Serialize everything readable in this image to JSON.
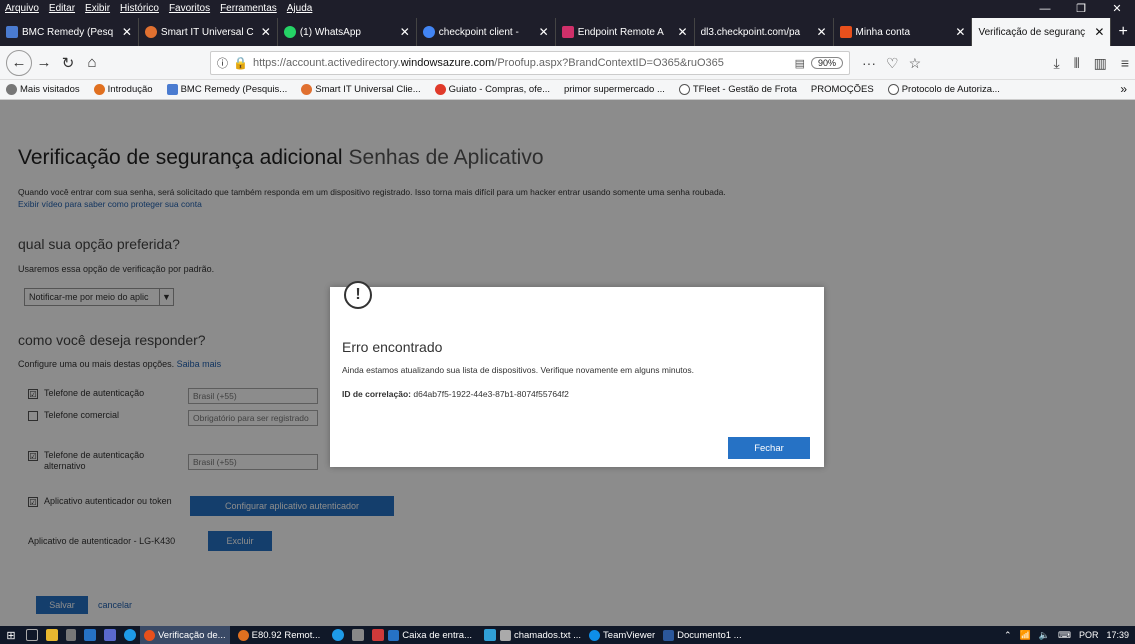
{
  "menu": [
    "Arquivo",
    "Editar",
    "Exibir",
    "Histórico",
    "Favoritos",
    "Ferramentas",
    "Ajuda"
  ],
  "window_controls": {
    "minimize": "—",
    "restore": "❐",
    "close": "✕"
  },
  "tabs": [
    {
      "label": "BMC Remedy (Pesq",
      "color": "#4a7bd0"
    },
    {
      "label": "Smart IT Universal C",
      "color": "#e07030"
    },
    {
      "label": "(1) WhatsApp",
      "color": "#25d366"
    },
    {
      "label": "checkpoint client -",
      "color": "#4285f4"
    },
    {
      "label": "Endpoint Remote A",
      "color": "#d0306a"
    },
    {
      "label": "dl3.checkpoint.com/pa",
      "color": "#888888"
    },
    {
      "label": "Minha conta",
      "color": "#e8501c"
    },
    {
      "label": "Verificação de seguranç",
      "color": "#f5f6f7"
    }
  ],
  "new_tab": "+",
  "nav": {
    "back": "←",
    "forward": "→",
    "reload": "↻",
    "home": "⌂",
    "info": "ⓘ",
    "url_prefix": "https://account.activedirectory.",
    "url_domain": "windowsazure.com",
    "url_suffix": "/Proofup.aspx?BrandContextID=O365&ruO365",
    "zoom": "90%",
    "more": "···",
    "pocket": "♡",
    "star": "☆",
    "download": "⤓",
    "library": "⫴",
    "sidebar": "▥",
    "hamburger": "≡"
  },
  "bookmarks": [
    {
      "label": "Mais visitados",
      "color": "#777777"
    },
    {
      "label": "Introdução",
      "color": "#e07020"
    },
    {
      "label": "BMC Remedy (Pesquis...",
      "color": "#4a7bd0"
    },
    {
      "label": "Smart IT Universal Clie...",
      "color": "#e07030"
    },
    {
      "label": "Guiato - Compras, ofe...",
      "color": "#e03a2a"
    },
    {
      "label": "primor supermercado ...",
      "color": "#ffffff"
    },
    {
      "label": "TFleet - Gestão de Frota",
      "color": "#555555"
    },
    {
      "label": "PROMOÇÕES",
      "color": "#ffffff"
    },
    {
      "label": "Protocolo de Autoriza...",
      "color": "#555555"
    }
  ],
  "bookmark_overflow": "»",
  "page": {
    "title": "Verificação de segurança adicional",
    "subtitle": "Senhas de Aplicativo",
    "intro": "Quando você entrar com sua senha, será solicitado que também responda em um dispositivo registrado. Isso torna mais difícil para um hacker entrar usando somente uma senha roubada.",
    "intro_link": "Exibir vídeo para saber como proteger sua conta",
    "preferred_heading": "qual sua opção preferida?",
    "preferred_note": "Usaremos essa opção de verificação por padrão.",
    "preferred_select": "Notificar-me por meio do aplic",
    "respond_heading": "como você deseja responder?",
    "respond_note": "Configure uma ou mais destas opções.",
    "respond_link": "Saiba mais",
    "options": [
      {
        "label": "Telefone de autenticação",
        "checked": "☑",
        "input": "Brasil (+55)"
      },
      {
        "label": "Telefone comercial",
        "checked": "",
        "input": "Obrigatório para ser registrado"
      },
      {
        "label": "Telefone de autenticação alternativo",
        "checked": "☑",
        "input": "Brasil (+55)"
      },
      {
        "label": "Aplicativo autenticador ou token",
        "checked": "☑",
        "input": ""
      }
    ],
    "config_app_button": "Configurar aplicativo autenticador",
    "authenticator_label": "Aplicativo de autenticador - LG-K430",
    "delete_button": "Excluir",
    "save_button": "Salvar",
    "cancel_link": "cancelar"
  },
  "dialog": {
    "icon": "!",
    "title": "Erro encontrado",
    "message": "Ainda estamos atualizando sua lista de dispositivos. Verifique novamente em alguns minutos.",
    "correlation_label": "ID de correlação:",
    "correlation_id": "d64ab7f5-1922-44e3-87b1-8074f55764f2",
    "close_button": "Fechar"
  },
  "taskbar": {
    "items": [
      {
        "label": "Verificação de...",
        "color": "#e8501c"
      },
      {
        "label": "E80.92 Remot...",
        "color": "#e07020"
      },
      {
        "label": "Caixa de entra...",
        "color": "#2672c5"
      },
      {
        "label": "chamados.txt ...",
        "color": "#aaaaaa"
      },
      {
        "label": "TeamViewer",
        "color": "#0e8ee9"
      },
      {
        "label": "Documento1 ...",
        "color": "#2b579a"
      }
    ],
    "language": "POR",
    "time": "17:39"
  }
}
